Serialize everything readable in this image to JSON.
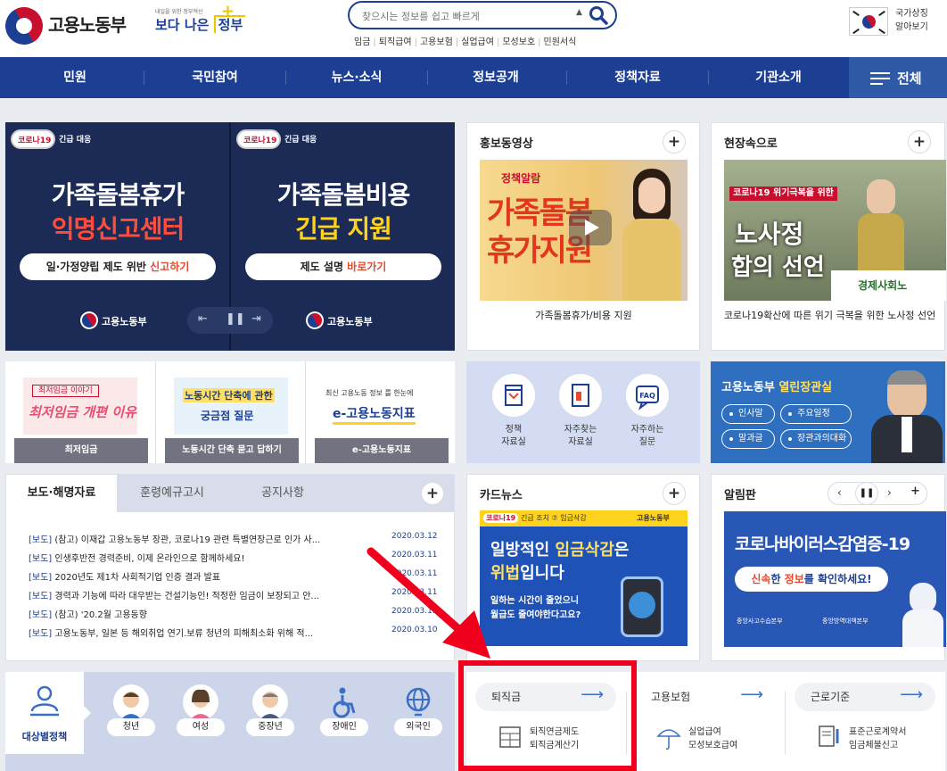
{
  "header": {
    "logo_text": "고용노동부",
    "slogan_small": "내일을 위한 정부혁신",
    "slogan_big": "보다 나은",
    "slogan_gov": "정부",
    "search_placeholder": "찾으시는 정보를 쉽고 빠르게",
    "quick_links": [
      "임금",
      "퇴직급여",
      "고용보험",
      "실업급여",
      "모성보호",
      "민원서식"
    ],
    "symbol_label_1": "국가상징",
    "symbol_label_2": "알아보기"
  },
  "nav": {
    "items": [
      "민원",
      "국민참여",
      "뉴스·소식",
      "정보공개",
      "정책자료",
      "기관소개"
    ],
    "all_label": "전체"
  },
  "banner": {
    "badge": "코로나19",
    "badge_tag": "긴급 대응",
    "left": {
      "title1": "가족돌봄휴가",
      "title2": "익명신고센터",
      "cta_a": "일·가정양립 제도 위반 ",
      "cta_b": "신고하기"
    },
    "right": {
      "title1": "가족돌봄비용",
      "title2": "긴급 지원",
      "cta_a": "제도 설명 ",
      "cta_b": "바로가기"
    },
    "footer": "고용노동부"
  },
  "promo_video": {
    "title": "홍보동영상",
    "thumb_line_top": "정책알람",
    "thumb_line1": "가족돌봄",
    "thumb_line2": "휴가지원",
    "caption": "가족돌봄휴가/비용 지원"
  },
  "field_news": {
    "title": "현장속으로",
    "thumb_tag": "코로나19 위기극복을 위한",
    "thumb_line1": "노사정",
    "thumb_line2": "합의 선언",
    "thumb_org": "경제사회노",
    "caption": "코로나19확산에 따른 위기 극복을 위한 노사정 선언"
  },
  "mid_cards": [
    {
      "thumb_top": "최저임금 이야기",
      "thumb_main": "최저임금 개편 이유",
      "label": "최저임금"
    },
    {
      "thumb_top": "노동시간 단축에 관한",
      "thumb_main": "궁금점 질문",
      "label": "노동시간 단축 묻고 답하기"
    },
    {
      "thumb_top": "최신 고용노동 정보 를 한눈에",
      "thumb_main": "e-고용노동지표",
      "label": "e-고용노동지표"
    }
  ],
  "resources": [
    {
      "label1": "정책",
      "label2": "자료실"
    },
    {
      "label1": "자주찾는",
      "label2": "자료실"
    },
    {
      "label1": "자주하는",
      "label2": "질문"
    }
  ],
  "minister": {
    "title_a": "고용노동부 ",
    "title_b": "열린장관실",
    "buttons": [
      "인사말",
      "주요일정",
      "말과글",
      "장관과의대화"
    ]
  },
  "news": {
    "tabs": [
      "보도·해명자료",
      "훈령예규고시",
      "공지사항"
    ],
    "rows": [
      {
        "tag": "[보도]",
        "text": " (참고) 이재갑 고용노동부 장관, 코로나19 관련 특별연장근로 인가 사...",
        "date": "2020.03.12"
      },
      {
        "tag": "[보도]",
        "text": " 인생후반전 경력준비, 이제 온라인으로 함께하세요!",
        "date": "2020.03.11"
      },
      {
        "tag": "[보도]",
        "text": " 2020년도 제1차 사회적기업 인증 결과 발표",
        "date": "2020.03.11"
      },
      {
        "tag": "[보도]",
        "text": " 경력과 기능에 따라 대우받는 건설기능인! 적정한 임금이 보장되고 안...",
        "date": "2020.03.11"
      },
      {
        "tag": "[보도]",
        "text": " (참고) '20.2월 고용동향",
        "date": "2020.03.11"
      },
      {
        "tag": "[보도]",
        "text": " 고용노동부, 일본 등 해외취업 연기.보류 청년의 피해최소화 위해 적...",
        "date": "2020.03.10"
      }
    ]
  },
  "card_news": {
    "title": "카드뉴스",
    "badge": "코로나19",
    "badge_tag": "긴급 조치 ⑦ 임금삭감",
    "line1": "일방적인 ",
    "line1_hl": "임금삭감",
    "line1_end": "은",
    "line2_hl": "위법",
    "line2_end": "입니다",
    "sub1": "일하는 시간이 줄었으니",
    "sub2": "월급도 줄여야한다고요?",
    "org": "고용노동부"
  },
  "notice": {
    "title": "알림판",
    "main": "코로나바이러스감염증-19",
    "sub_a": "신속",
    "sub_b": "한 ",
    "sub_c": "정보",
    "sub_d": "를 확인하세요!",
    "org1": "중앙사고수습본부",
    "org2": "중앙방역대책본부"
  },
  "policy": {
    "left_label": "대상별정책",
    "targets": [
      "청년",
      "여성",
      "중장년",
      "장애인",
      "외국인"
    ]
  },
  "services": [
    {
      "title": "퇴직금",
      "line1": "퇴직연금제도",
      "line2": "퇴직금계산기"
    },
    {
      "title": "고용보험",
      "line1": "실업급여",
      "line2": "모성보호급여"
    },
    {
      "title": "근로기준",
      "line1": "표준근로계약서",
      "line2": "임금체불신고"
    }
  ],
  "colors": {
    "brand": "#1c3f94",
    "highlight_frame": "#f0001c",
    "arrow": "#f0001c"
  }
}
